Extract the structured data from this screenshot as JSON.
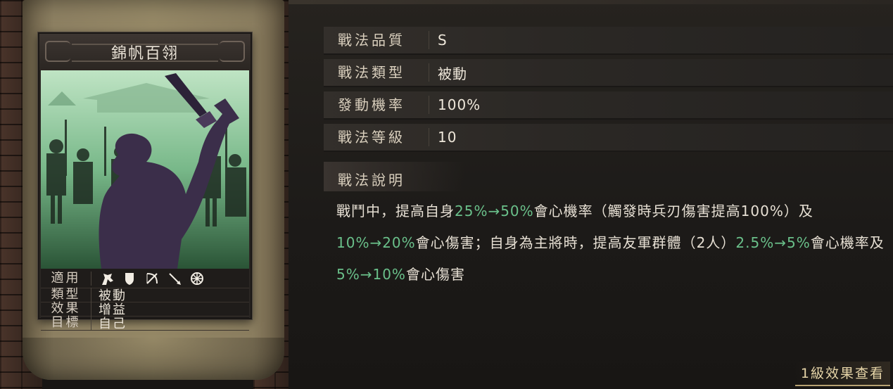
{
  "card": {
    "title": "錦帆百翎",
    "rows": [
      {
        "key": "適用",
        "icons": [
          "cavalry-icon",
          "shield-icon",
          "archer-icon",
          "spear-icon",
          "siege-icon"
        ]
      },
      {
        "key": "類型",
        "value": "被動"
      },
      {
        "key": "效果",
        "value": "增益"
      },
      {
        "key": "目標",
        "value": "自己"
      }
    ]
  },
  "info": {
    "quality_label": "戰法品質",
    "quality_value": "S",
    "type_label": "戰法類型",
    "type_value": "被動",
    "rate_label": "發動機率",
    "rate_value": "100%",
    "level_label": "戰法等級",
    "level_value": "10"
  },
  "description": {
    "heading": "戰法說明",
    "segments": [
      {
        "text": "戰鬥中，提高自身",
        "hl": false
      },
      {
        "text": "25%→50%",
        "hl": true
      },
      {
        "text": "會心機率（觸發時兵刃傷害提高100%）及",
        "hl": false
      },
      {
        "text": "10%→20%",
        "hl": true
      },
      {
        "text": "會心傷害；自身為主將時，提高友軍群體（2人）",
        "hl": false
      },
      {
        "text": "2.5%→5%",
        "hl": true
      },
      {
        "text": "會心機率及",
        "hl": false
      },
      {
        "text": "5%→10%",
        "hl": true
      },
      {
        "text": "會心傷害",
        "hl": false
      }
    ]
  },
  "footer": {
    "view_link": "1級效果查看"
  },
  "colors": {
    "highlight": "#6ac08a",
    "text": "#e7e0d4",
    "label": "#d9cfbd"
  }
}
